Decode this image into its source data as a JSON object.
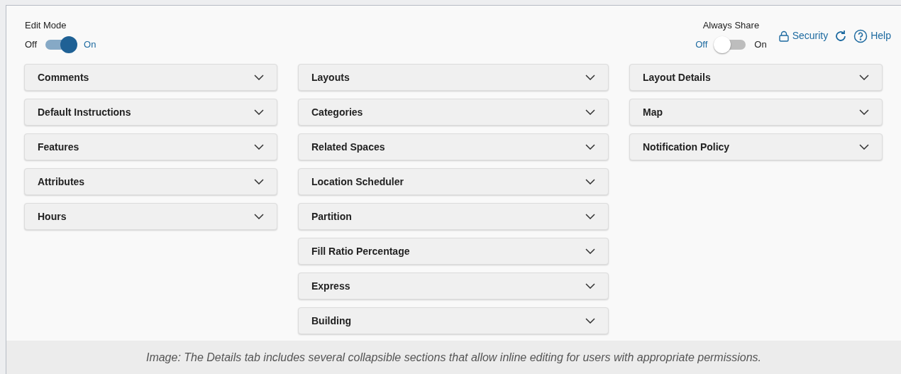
{
  "toggles": [
    {
      "label": "Edit Mode",
      "off_label": "Off",
      "on_label": "On",
      "on": true
    },
    {
      "label": "Always Share",
      "off_label": "Off",
      "on_label": "On",
      "on": false
    }
  ],
  "links": [
    {
      "kind": "lock",
      "label": "Security"
    },
    {
      "kind": "refresh"
    },
    {
      "kind": "help",
      "label": "Help"
    }
  ],
  "columns": [
    [
      {
        "title": "Comments",
        "expanded": false
      },
      {
        "title": "Default Instructions",
        "expanded": false
      },
      {
        "title": "Features",
        "expanded": false
      },
      {
        "title": "Attributes",
        "expanded": false
      },
      {
        "title": "Hours",
        "expanded": false
      }
    ],
    [
      {
        "title": "Layouts",
        "expanded": false
      },
      {
        "title": "Categories",
        "expanded": false
      },
      {
        "title": "Related Spaces",
        "expanded": false
      },
      {
        "title": "Location Scheduler",
        "expanded": false
      },
      {
        "title": "Partition",
        "expanded": false
      },
      {
        "title": "Fill Ratio Percentage",
        "expanded": false
      },
      {
        "title": "Express",
        "expanded": false
      },
      {
        "title": "Building",
        "expanded": false
      }
    ],
    [
      {
        "title": "Layout Details",
        "expanded": false
      },
      {
        "title": "Map",
        "expanded": false
      },
      {
        "title": "Notification Policy",
        "expanded": false
      }
    ]
  ],
  "caption": "Image: The Details tab includes several collapsible sections that allow inline editing for users with appropriate permissions."
}
